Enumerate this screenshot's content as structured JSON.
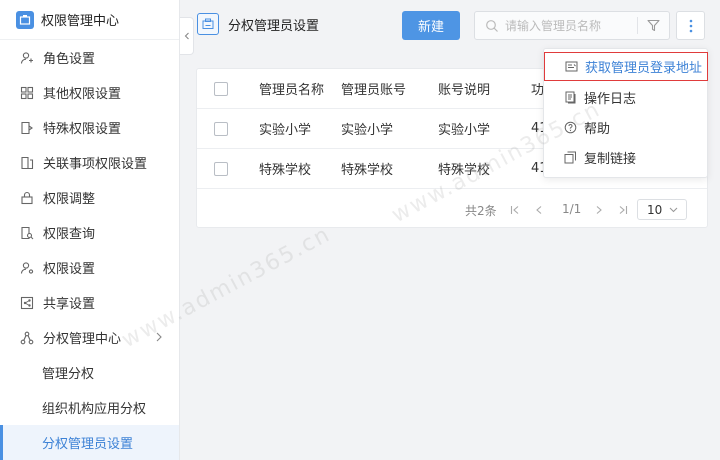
{
  "sidebar": {
    "title": "权限管理中心",
    "items": [
      {
        "label": "角色设置",
        "icon": "user-icon"
      },
      {
        "label": "其他权限设置",
        "icon": "grid-icon"
      },
      {
        "label": "特殊权限设置",
        "icon": "tag-icon"
      },
      {
        "label": "关联事项权限设置",
        "icon": "link-icon"
      },
      {
        "label": "权限调整",
        "icon": "lock-icon"
      },
      {
        "label": "权限查询",
        "icon": "search-doc-icon"
      },
      {
        "label": "权限设置",
        "icon": "user-gear-icon"
      },
      {
        "label": "共享设置",
        "icon": "share-icon"
      },
      {
        "label": "分权管理中心",
        "icon": "org-icon"
      }
    ],
    "sub_items": [
      {
        "label": "管理分权",
        "active": false
      },
      {
        "label": "组织机构应用分权",
        "active": false
      },
      {
        "label": "分权管理员设置",
        "active": true
      }
    ]
  },
  "header": {
    "title": "分权管理员设置",
    "new_button": "新建",
    "search_placeholder": "请输入管理员名称"
  },
  "table": {
    "columns": [
      "管理员名称",
      "管理员账号",
      "账号说明",
      "功"
    ],
    "rows": [
      [
        "实验小学",
        "实验小学",
        "实验小学",
        "41"
      ],
      [
        "特殊学校",
        "特殊学校",
        "特殊学校",
        "41"
      ]
    ]
  },
  "pagination": {
    "total": "共2条",
    "page": "1/1",
    "page_size": "10"
  },
  "menu": {
    "items": [
      {
        "label": "获取管理员登录地址",
        "icon": "address-card-icon",
        "highlighted": true
      },
      {
        "label": "操作日志",
        "icon": "log-icon",
        "highlighted": false
      },
      {
        "label": "帮助",
        "icon": "help-icon",
        "highlighted": false
      },
      {
        "label": "复制链接",
        "icon": "copy-icon",
        "highlighted": false
      }
    ]
  },
  "watermark": "www.admin365.cn",
  "colors": {
    "accent": "#4a90e2",
    "highlight_border": "#e03b3b"
  }
}
